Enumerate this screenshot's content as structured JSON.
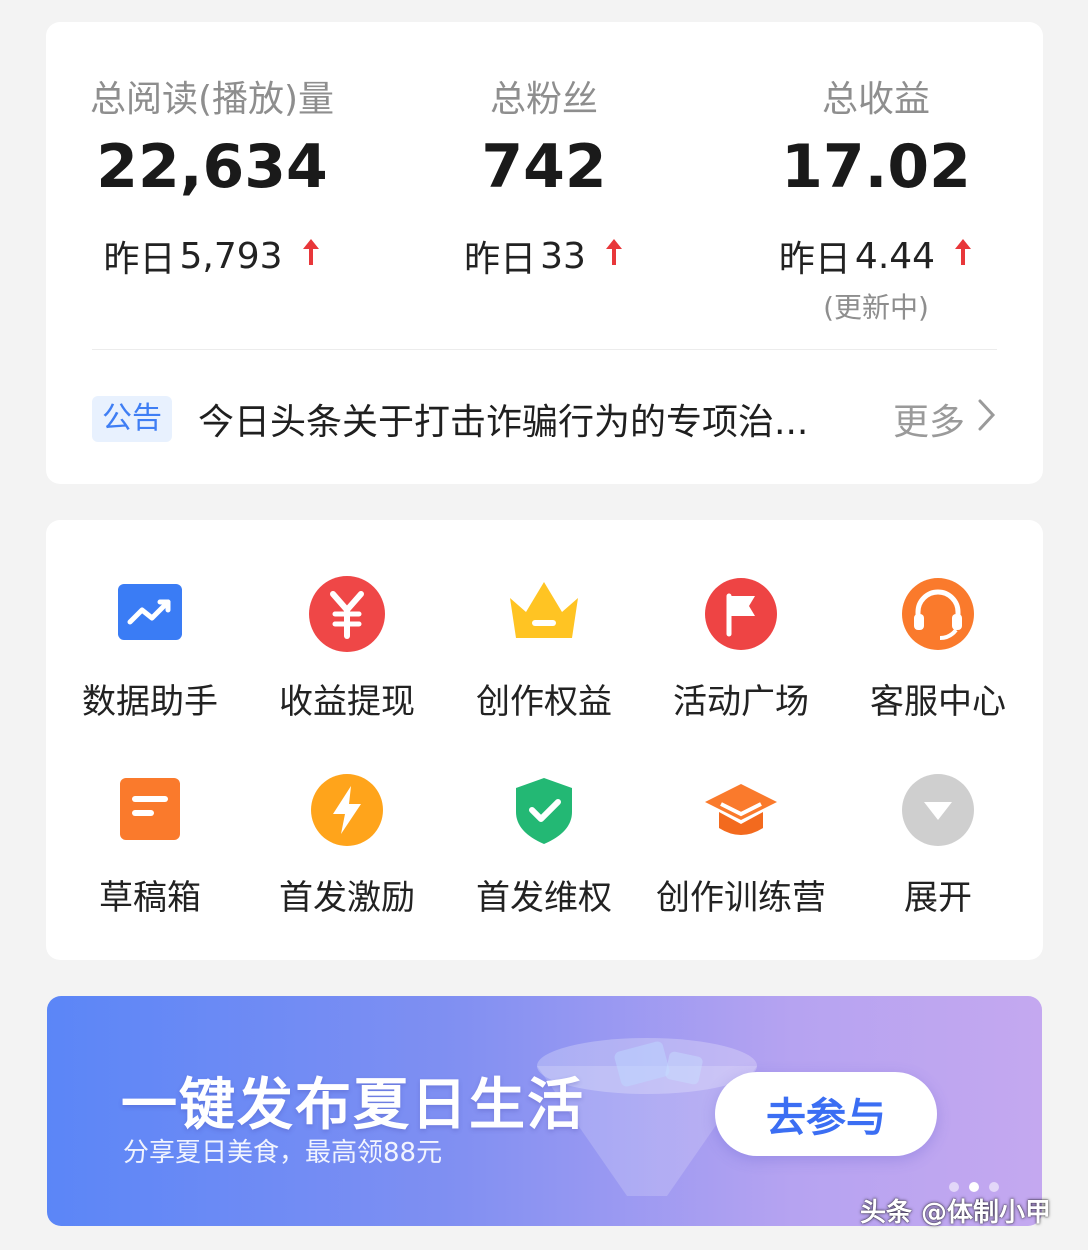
{
  "stats": [
    {
      "label": "总阅读(播放)量",
      "value": "22,634",
      "delta_prefix": "昨日",
      "delta_value": "5,793",
      "note": ""
    },
    {
      "label": "总粉丝",
      "value": "742",
      "delta_prefix": "昨日",
      "delta_value": "33",
      "note": ""
    },
    {
      "label": "总收益",
      "value": "17.02",
      "delta_prefix": "昨日",
      "delta_value": "4.44",
      "note": "(更新中)"
    }
  ],
  "colors": {
    "accent_blue": "#3f7ef4",
    "up_arrow": "#e8373a",
    "muted": "#8e8e8e"
  },
  "notice": {
    "tag": "公告",
    "text": "今日头条关于打击诈骗行为的专项治...",
    "more": "更多"
  },
  "tools": [
    {
      "label": "数据助手",
      "icon": "chart-trend-icon"
    },
    {
      "label": "收益提现",
      "icon": "yuan-icon"
    },
    {
      "label": "创作权益",
      "icon": "crown-icon"
    },
    {
      "label": "活动广场",
      "icon": "flag-icon"
    },
    {
      "label": "客服中心",
      "icon": "headset-icon"
    },
    {
      "label": "草稿箱",
      "icon": "draft-icon"
    },
    {
      "label": "首发激励",
      "icon": "lightning-icon"
    },
    {
      "label": "首发维权",
      "icon": "shield-check-icon"
    },
    {
      "label": "创作训练营",
      "icon": "graduation-cap-icon"
    },
    {
      "label": "展开",
      "icon": "expand-down-icon"
    }
  ],
  "banner": {
    "title": "一键发布夏日生活",
    "subtitle": "分享夏日美食，最高领88元",
    "button": "去参与"
  },
  "watermark": "头条 @体制小甲"
}
